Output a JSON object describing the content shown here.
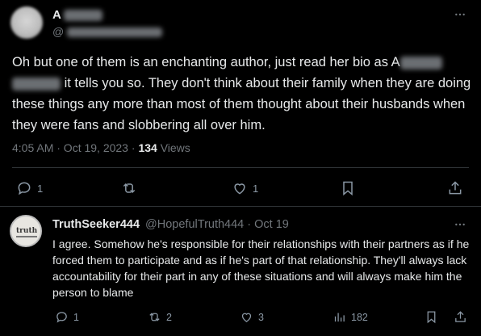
{
  "main_tweet": {
    "name_visible": "A",
    "handle_visible": "@",
    "text_before_redact": "Oh but one of them is an enchanting author, just read her bio as A",
    "text_after_redact": " it tells you so.  They don't think about their family when they are doing these things any more than most of them thought about their husbands when they were fans and slobbering all over him.",
    "timestamp": "4:05 AM · Oct 19, 2023",
    "separator": "·",
    "views_count": "134",
    "views_label": "Views",
    "actions": {
      "reply_count": "1",
      "like_count": "1"
    }
  },
  "reply_tweet": {
    "name": "TruthSeeker444",
    "handle_date": "@HopefulTruth444 · Oct 19",
    "avatar_text": "truth",
    "text": "I agree. Somehow he's responsible for their relationships with their partners as if he forced them to participate and as if he's part of that relationship. They'll always lack accountability for their part in any of these situations and will always make him the person to blame",
    "actions": {
      "reply_count": "1",
      "retweet_count": "2",
      "like_count": "3",
      "views_count": "182"
    }
  },
  "colors": {
    "background": "#000000",
    "text_primary": "#e7e9ea",
    "text_secondary": "#71767b",
    "divider": "#2f3336"
  }
}
